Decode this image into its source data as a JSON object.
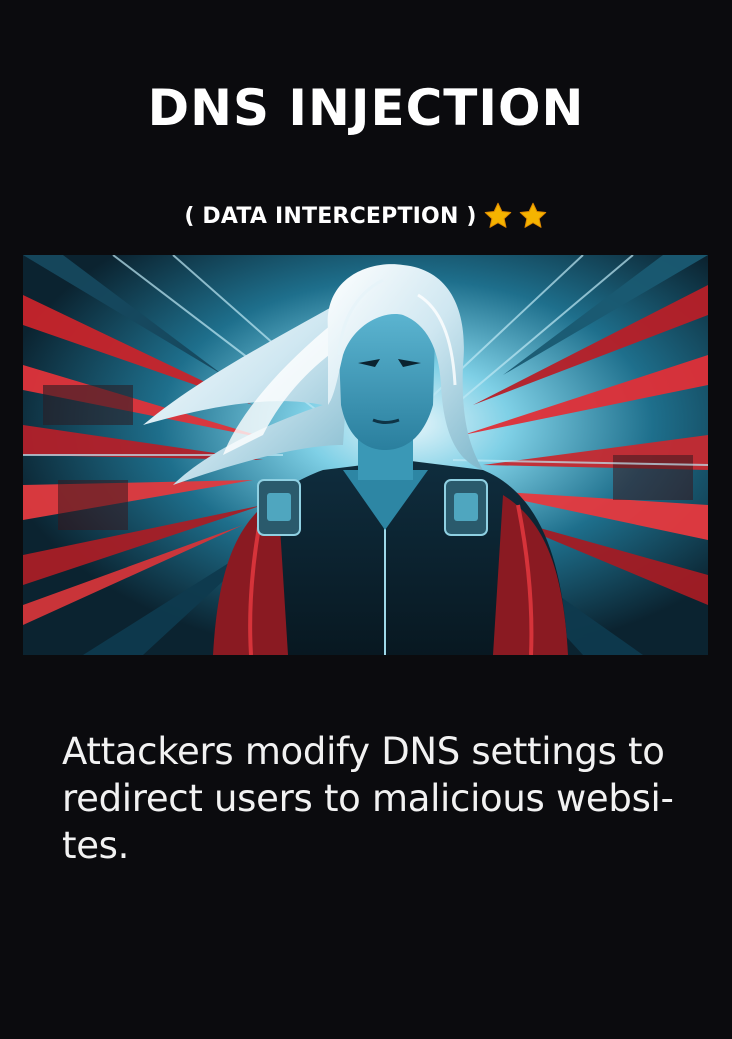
{
  "card": {
    "title": "DNS INJECTION",
    "subtitle": "( DATA INTERCEPTION )",
    "rating": 2,
    "rating_icon": "star-icon",
    "accent_color": "#f5b400",
    "description": "Attackers modify DNS settings to redirect users to malicious websi-tes."
  }
}
